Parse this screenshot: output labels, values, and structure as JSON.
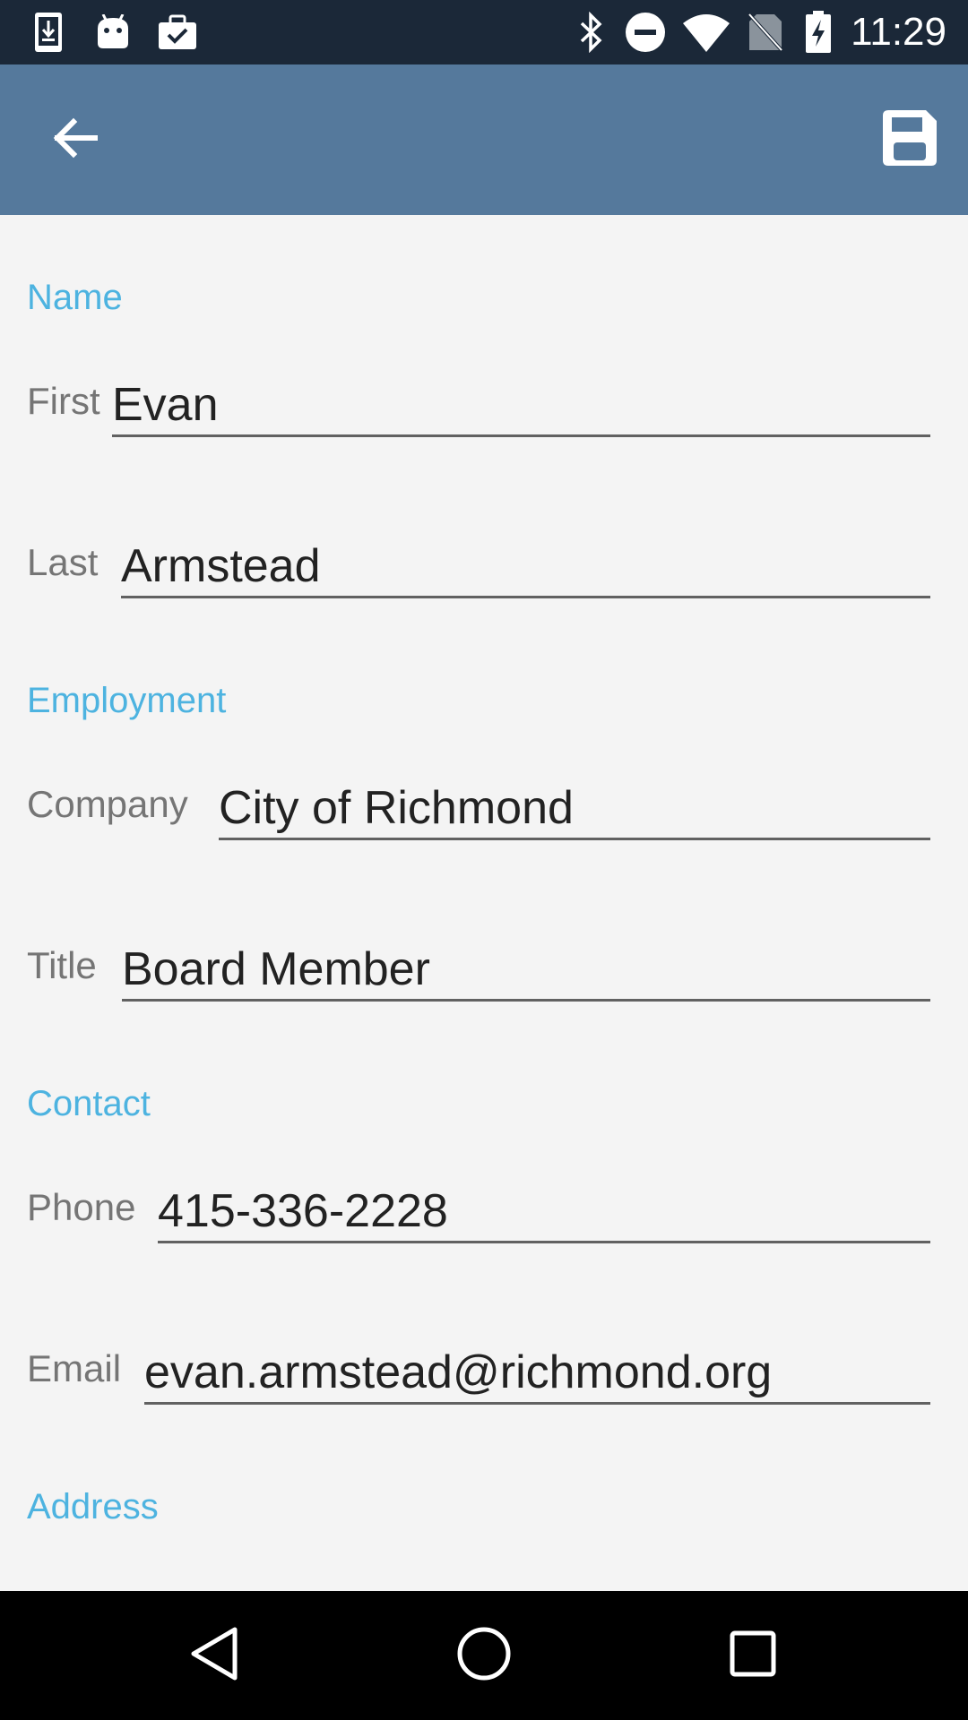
{
  "status_bar": {
    "time": "11:29",
    "left_icons": [
      "download-icon",
      "android-icon",
      "briefcase-check-icon"
    ],
    "right_icons": [
      "bluetooth-icon",
      "do-not-disturb-icon",
      "wifi-icon",
      "no-sim-icon",
      "battery-charging-icon"
    ]
  },
  "app_bar": {
    "color": "#55799c",
    "back_icon": "arrow-back-icon",
    "save_icon": "save-icon"
  },
  "sections": {
    "name": "Name",
    "employment": "Employment",
    "contact": "Contact",
    "address": "Address"
  },
  "fields": {
    "first": {
      "label": "First",
      "value": "Evan"
    },
    "last": {
      "label": "Last",
      "value": "Armstead"
    },
    "company": {
      "label": "Company",
      "value": "City of Richmond"
    },
    "title": {
      "label": "Title",
      "value": "Board Member"
    },
    "phone": {
      "label": "Phone",
      "value": "415-336-2228"
    },
    "email": {
      "label": "Email",
      "value": "evan.armstead@richmond.org"
    }
  },
  "colors": {
    "accent": "#4db3e0",
    "status_bar": "#1b2838",
    "nav_bar": "#000000",
    "background": "#f4f4f4"
  },
  "nav_bar": {
    "icons": [
      "back-triangle-icon",
      "home-circle-icon",
      "recents-square-icon"
    ]
  }
}
